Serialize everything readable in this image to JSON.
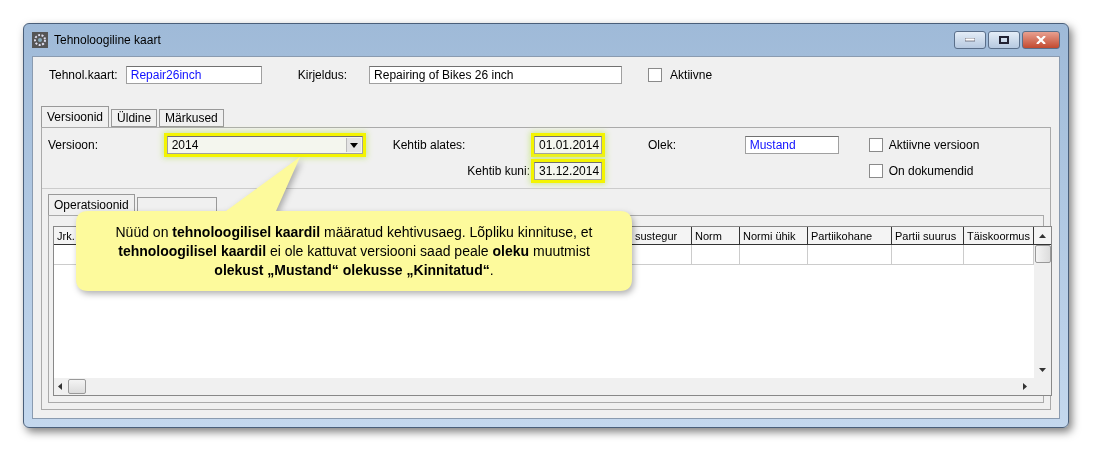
{
  "window": {
    "title": "Tehnoloogiline kaart"
  },
  "header": {
    "card_label": "Tehnol.kaart:",
    "card_value": "Repair26inch",
    "description_label": "Kirjeldus:",
    "description_value": "Repairing of Bikes 26 inch",
    "active_label": "Aktiivne",
    "active_checked": false
  },
  "tabs": [
    {
      "label": "Versioonid",
      "selected": true
    },
    {
      "label": "Üldine",
      "selected": false
    },
    {
      "label": "Märkused",
      "selected": false
    }
  ],
  "version": {
    "version_label": "Versioon:",
    "version_value": "2014",
    "valid_from_label": "Kehtib alates:",
    "valid_from": "01.01.2014",
    "valid_to_label": "Kehtib kuni:",
    "valid_to": "31.12.2014",
    "status_label": "Olek:",
    "status_value": "Mustand",
    "active_version_label": "Aktiivne versioon",
    "active_version_checked": false,
    "has_documents_label": "On dokumendid",
    "has_documents_checked": false
  },
  "sub_tabs": [
    {
      "label": "Operatsioonid",
      "selected": true
    },
    {
      "selected": false
    }
  ],
  "table": {
    "columns": [
      "Jrk.",
      "sustegur",
      "Norm",
      "Normi ühik",
      "Partiikohane",
      "Partii suurus",
      "Täiskoormus"
    ]
  },
  "callout": {
    "text": "Nüüd on **tehnoloogilisel kaardil** määratud kehtivusaeg. Lõpliku kinnituse, et **tehnoloogilisel kaardil** ei ole kattuvat versiooni saad peale **oleku** muutmist **olekust „Mustand“ olekusse „Kinnitatud“**."
  }
}
